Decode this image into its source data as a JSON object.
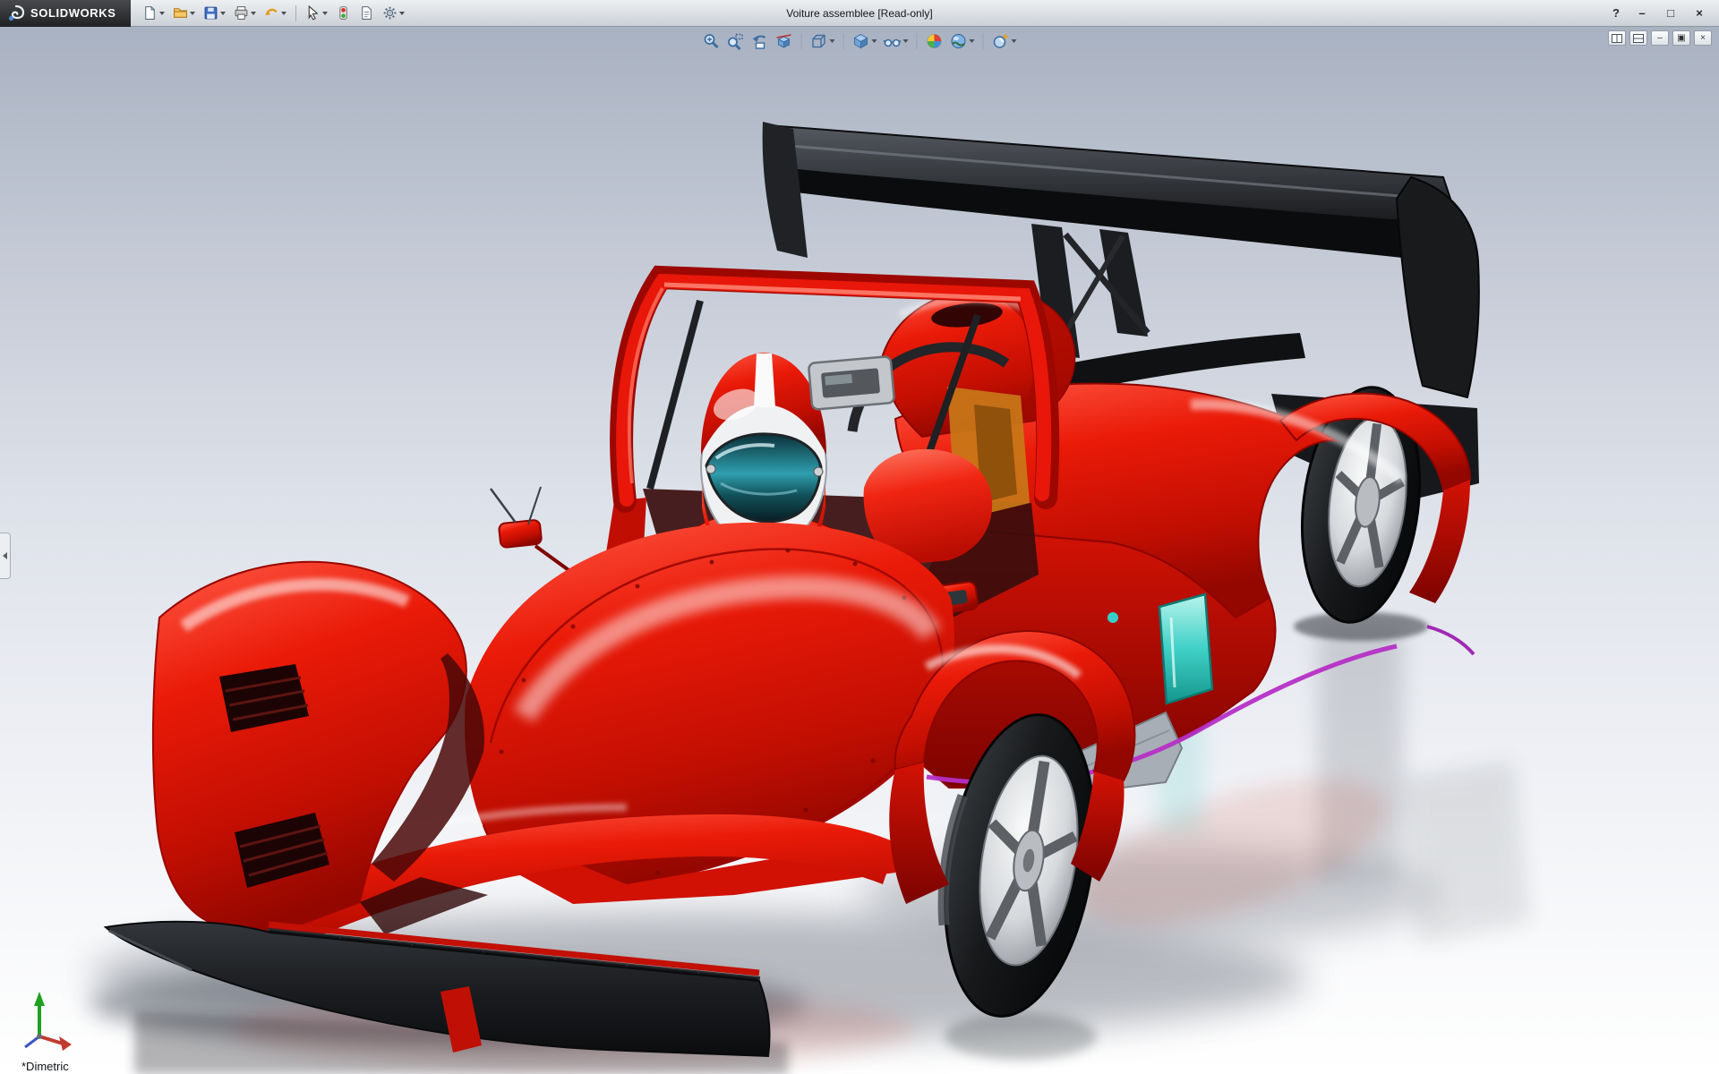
{
  "titlebar": {
    "brand": "SOLIDWORKS",
    "title": "Voiture assemblee [Read-only]",
    "help_glyph": "?",
    "window_controls": {
      "minimize": "–",
      "maximize": "□",
      "close": "×"
    },
    "standard_toolbar": [
      "new-document",
      "open",
      "save",
      "print",
      "undo",
      "select",
      "rebuild",
      "file-properties",
      "options"
    ]
  },
  "hud_toolbar": [
    "zoom-to-fit",
    "zoom-to-area",
    "previous-view",
    "section-view",
    "view-orientation",
    "display-style",
    "hide-show-items",
    "edit-appearance",
    "apply-scene",
    "view-settings"
  ],
  "doc_controls": {
    "minimize": "–",
    "restore": "▣",
    "close": "×"
  },
  "viewport": {
    "orientation_label": "*Dimetric",
    "background_top": "#a9b2c2",
    "background_bottom": "#ffffff",
    "model": {
      "name_visible": false,
      "body_color": "#e11505",
      "wing_color": "#141414",
      "window_accent": "#35cfc8",
      "trim_accent": "#b62fc6",
      "harness_color": "#e3d31f",
      "rim_color": "#c9ccd0",
      "helmet_colors": [
        "#e11505",
        "#f0f1f3"
      ]
    }
  }
}
